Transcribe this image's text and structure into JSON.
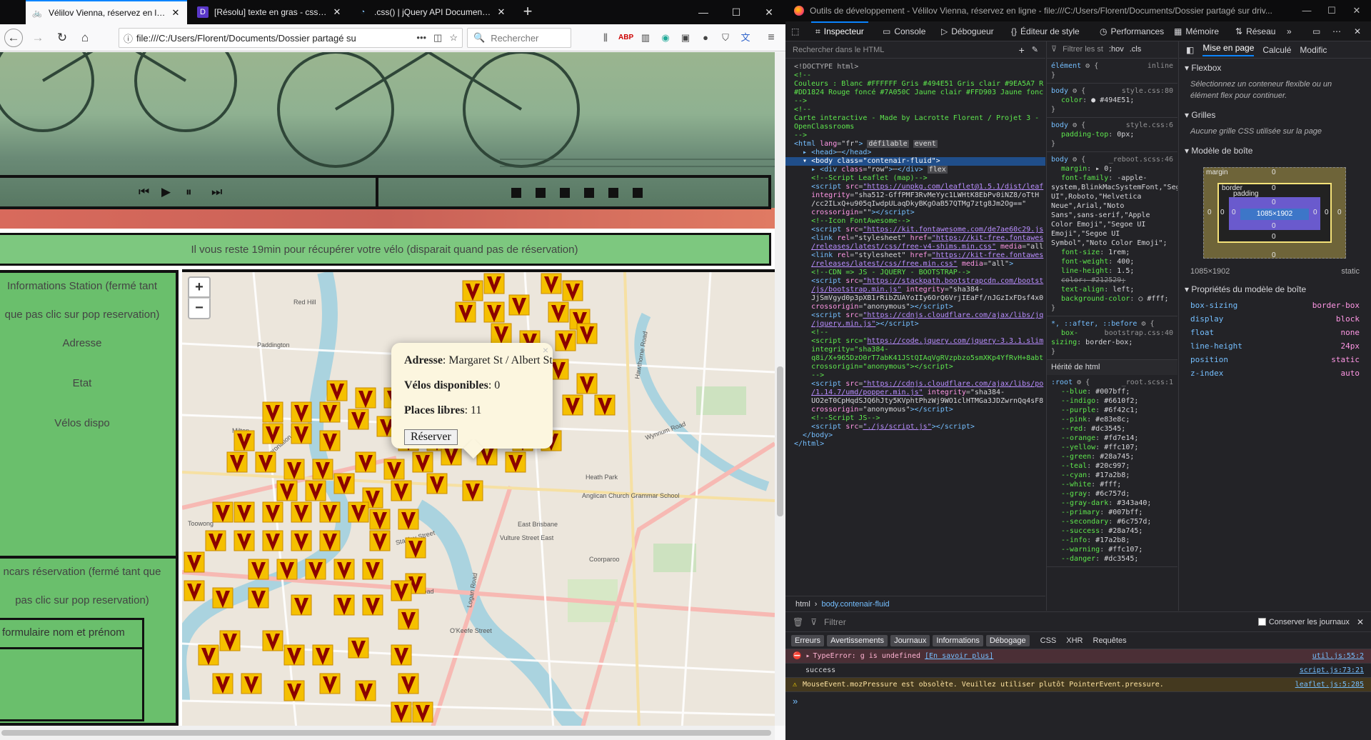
{
  "browser": {
    "tabs": [
      {
        "label": "Vélilov Vienna, réservez en ligne",
        "active": true,
        "favicon": "bike-icon"
      },
      {
        "label": "[Résolu] texte en gras - css par",
        "active": false,
        "favicon": "oc-icon"
      },
      {
        "label": ".css() | jQuery API Documentat",
        "active": false,
        "favicon": "jquery-icon"
      }
    ],
    "url": "file:///C:/Users/Florent/Documents/Dossier partagé su",
    "search_placeholder": "Rechercher",
    "url_dots": "•••"
  },
  "page": {
    "notice": "Il vous reste 19min pour récupérer votre vélo (disparait quand pas de réservation)",
    "panel": {
      "line1": "Informations Station (fermé tant",
      "line2": "que pas clic sur pop reservation)",
      "adresse": "Adresse",
      "etat": "Etat",
      "velos": "Vélos dispo",
      "encart1": "ncars réservation (fermé tant que",
      "encart2": "pas clic sur pop reservation)",
      "form": "formulaire nom et prénom"
    },
    "map": {
      "zoom_in": "+",
      "zoom_out": "−",
      "popup": {
        "adresse_label": "Adresse",
        "adresse_value": ": Margaret St / Albert St",
        "velos_label": "Vélos disponibles",
        "velos_value": ": 0",
        "places_label": "Places libres",
        "places_value": ": 11",
        "button": "Réserver",
        "close": "×"
      },
      "labels": [
        "Red Hill",
        "Paddington",
        "Milton",
        "Toowong",
        "Coronation Drive",
        "East Brisbane",
        "Anglican Church Grammar School",
        "Coorparoo",
        "Wynnum Road",
        "Vulture Street East",
        "Logan Road",
        "Park Road",
        "O'Keefe Street",
        "Hawthorne Road",
        "Heath Park",
        "Stanley Street"
      ]
    }
  },
  "devtools": {
    "title": "Outils de développement - Vélilov Vienna, réservez en ligne - file:///C:/Users/Florent/Documents/Dossier partagé sur driv...",
    "tabs": [
      "Inspecteur",
      "Console",
      "Débogueur",
      "Éditeur de style",
      "Performances",
      "Mémoire",
      "Réseau"
    ],
    "html_search": "Rechercher dans le HTML",
    "breadcrumb": [
      "html",
      "body.contenair-fluid"
    ],
    "rules_filter": "Filtrer les st",
    "hov": ":hov",
    "cls": ".cls",
    "layout_tabs": [
      "Mise en page",
      "Calculé",
      "Modific"
    ],
    "flexbox_title": "Flexbox",
    "flexbox_note": "Sélectionnez un conteneur flexible ou un élément flex pour continuer.",
    "grids_title": "Grilles",
    "grids_note": "Aucune grille CSS utilisée sur la page",
    "boxmodel_title": "Modèle de boîte",
    "box": {
      "margin": "margin",
      "border": "border",
      "padding": "padding",
      "content": "1085×1902",
      "size": "1085×1902",
      "position": "static",
      "zero": "0"
    },
    "props_title": "Propriétés du modèle de boîte",
    "props": [
      {
        "k": "box-sizing",
        "v": "border-box"
      },
      {
        "k": "display",
        "v": "block"
      },
      {
        "k": "float",
        "v": "none"
      },
      {
        "k": "line-height",
        "v": "24px"
      },
      {
        "k": "position",
        "v": "static"
      },
      {
        "k": "z-index",
        "v": "auto"
      }
    ],
    "console": {
      "filter": "Filtrer",
      "keep_logs": "Conserver les journaux",
      "cats": [
        "Erreurs",
        "Avertissements",
        "Journaux",
        "Informations",
        "Débogage",
        "CSS",
        "XHR",
        "Requêtes"
      ],
      "messages": [
        {
          "type": "err",
          "text": "TypeError: g is undefined",
          "extra": "[En savoir plus]",
          "src": "util.js:55:2"
        },
        {
          "type": "log",
          "text": "success",
          "extra": "",
          "src": "script.js:73:21"
        },
        {
          "type": "warn",
          "text": "MouseEvent.mozPressure est obsolète. Veuillez utiliser plutôt PointerEvent.pressure.",
          "extra": "",
          "src": "leaflet.js:5:285"
        }
      ]
    }
  },
  "colors": {
    "accent": "#0a84ff",
    "green": "#7dc87f",
    "marker": "#f5c000",
    "marker_v": "#8b0000",
    "popup": "#fcf6df"
  }
}
